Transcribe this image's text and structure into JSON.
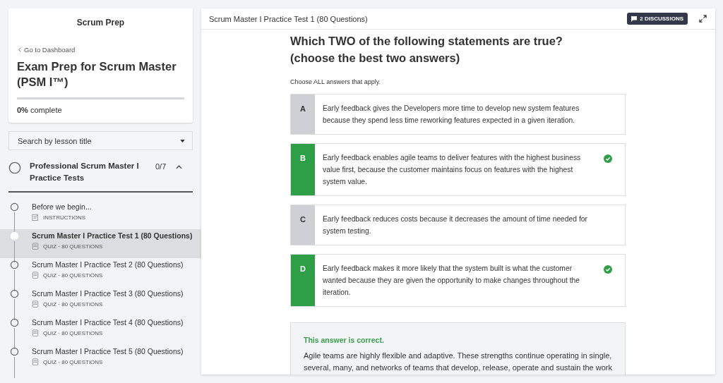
{
  "sidebar": {
    "brand": "Scrum Prep",
    "back_link": "Go to Dashboard",
    "course_title": "Exam Prep for Scrum Master (PSM I™)",
    "progress": {
      "level": 0,
      "percent": "0%",
      "label": "complete"
    },
    "search": {
      "placeholder": "Search by lesson title"
    },
    "section": {
      "title": "Professional Scrum Master I Practice Tests",
      "count": "0/7",
      "expanded": true
    },
    "lessons": [
      {
        "title": "Before we begin...",
        "meta": "INSTRUCTIONS",
        "kind": "instructions",
        "selected": false
      },
      {
        "title": "Scrum Master I Practice Test 1 (80 Questions)",
        "meta": "QUIZ · 80 QUESTIONS",
        "kind": "quiz",
        "selected": true
      },
      {
        "title": "Scrum Master I Practice Test 2 (80 Questions)",
        "meta": "QUIZ · 80 QUESTIONS",
        "kind": "quiz",
        "selected": false
      },
      {
        "title": "Scrum Master I Practice Test 3 (80 Questions)",
        "meta": "QUIZ · 80 QUESTIONS",
        "kind": "quiz",
        "selected": false
      },
      {
        "title": "Scrum Master I Practice Test 4 (80 Questions)",
        "meta": "QUIZ · 80 QUESTIONS",
        "kind": "quiz",
        "selected": false
      },
      {
        "title": "Scrum Master I Practice Test 5 (80 Questions)",
        "meta": "QUIZ · 80 QUESTIONS",
        "kind": "quiz",
        "selected": false
      }
    ]
  },
  "main": {
    "title": "Scrum Master I Practice Test 1 (80 Questions)",
    "discussions": "2 DISCUSSIONS",
    "question": "Which TWO of the following statements are true?\n(choose the best two answers)",
    "instruction": "Choose ALL answers that apply.",
    "answers": [
      {
        "letter": "A",
        "text": "Early feedback gives the Developers more time to develop new system features because they spend less time reworking features expected in a given iteration.",
        "correct": false
      },
      {
        "letter": "B",
        "text": "Early feedback enables agile teams to deliver features with the highest business value first, because the customer maintains focus on features with the highest system value.",
        "correct": true
      },
      {
        "letter": "C",
        "text": "Early feedback reduces costs because it decreases the amount of time needed for system testing.",
        "correct": false
      },
      {
        "letter": "D",
        "text": "Early feedback makes it more likely that the system built is what the customer wanted because they are given the opportunity to make changes throughout the iteration.",
        "correct": true
      }
    ],
    "feedback": {
      "verdict": "This answer is correct.",
      "explanation": "Agile teams are highly flexible and adaptive. These strengths continue operating in single, several, many, and networks of teams that develop, release, operate and sustain the work"
    }
  }
}
